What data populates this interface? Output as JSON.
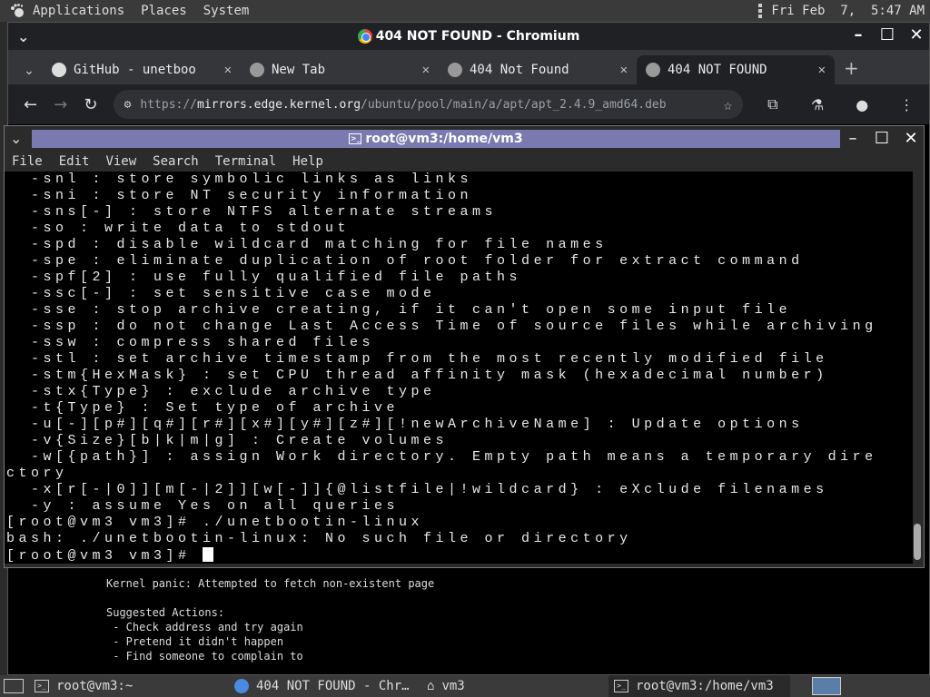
{
  "top_panel": {
    "menus": [
      "Applications",
      "Places",
      "System"
    ],
    "clock": "Fri Feb  7,  5:47 AM"
  },
  "chrome": {
    "window_title": "404 NOT FOUND - Chromium",
    "tabs": [
      {
        "label": "GitHub - unetboo",
        "icon": "github-icon"
      },
      {
        "label": "New Tab",
        "icon": "globe-icon"
      },
      {
        "label": "404 Not Found",
        "icon": "globe-icon"
      },
      {
        "label": "404 NOT FOUND",
        "icon": "globe-icon"
      }
    ],
    "url_prefix": "https://",
    "url_host": "mirrors.edge.kernel.org",
    "url_path": "/ubuntu/pool/main/a/apt/apt_2.4.9_amd64.deb",
    "page_lines": [
      "Kernel panic: Attempted to fetch non-existent page",
      "",
      "Suggested Actions:",
      " - Check address and try again",
      " - Pretend it didn't happen",
      " - Find someone to complain to"
    ]
  },
  "terminal": {
    "title": "root@vm3:/home/vm3",
    "menu": [
      "File",
      "Edit",
      "View",
      "Search",
      "Terminal",
      "Help"
    ],
    "lines": [
      "  -snl : store symbolic links as links",
      "  -sni : store NT security information",
      "  -sns[-] : store NTFS alternate streams",
      "  -so : write data to stdout",
      "  -spd : disable wildcard matching for file names",
      "  -spe : eliminate duplication of root folder for extract command",
      "  -spf[2] : use fully qualified file paths",
      "  -ssc[-] : set sensitive case mode",
      "  -sse : stop archive creating, if it can't open some input file",
      "  -ssp : do not change Last Access Time of source files while archiving",
      "  -ssw : compress shared files",
      "  -stl : set archive timestamp from the most recently modified file",
      "  -stm{HexMask} : set CPU thread affinity mask (hexadecimal number)",
      "  -stx{Type} : exclude archive type",
      "  -t{Type} : Set type of archive",
      "  -u[-][p#][q#][r#][x#][y#][z#][!newArchiveName] : Update options",
      "  -v{Size}[b|k|m|g] : Create volumes",
      "  -w[{path}] : assign Work directory. Empty path means a temporary dire",
      "ctory",
      "  -x[r[-|0]][m[-|2]][w[-]]{@listfile|!wildcard} : eXclude filenames",
      "  -y : assume Yes on all queries",
      "[root@vm3 vm3]# ./unetbootin-linux",
      "bash: ./unetbootin-linux: No such file or directory"
    ],
    "prompt": "[root@vm3 vm3]# "
  },
  "taskbar": {
    "items": [
      {
        "label": "root@vm3:~",
        "icon": "terminal-icon"
      },
      {
        "label": "404 NOT FOUND - Chr…",
        "icon": "chromium-icon"
      },
      {
        "label": "vm3",
        "icon": "home-folder-icon"
      },
      {
        "label": "root@vm3:/home/vm3",
        "icon": "terminal-icon"
      }
    ]
  }
}
